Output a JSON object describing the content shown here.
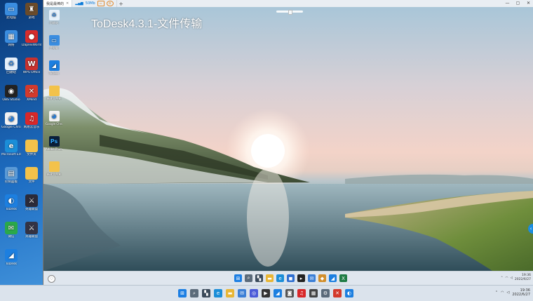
{
  "window": {
    "overlay_title": "ToDesk4.3.1-文件传输",
    "tabs": [
      {
        "label": "我是最棒的",
        "active": true
      },
      {
        "label": "50Mb",
        "active": false
      }
    ],
    "controls": {
      "minimize": "—",
      "maximize": "▢",
      "close": "✕"
    },
    "add_tab": "+"
  },
  "outer_desktop_icons": [
    {
      "label": "此电脑",
      "icon": "computer-icon",
      "color": "#3a8de0",
      "glyph": "▭"
    },
    {
      "label": "游戏",
      "icon": "game-icon",
      "color": "#6a4b2a",
      "glyph": "♜"
    },
    {
      "label": "网络",
      "icon": "network-icon",
      "color": "#3a8de0",
      "glyph": "▦"
    },
    {
      "label": "DaplexWorld",
      "icon": "app-icon",
      "color": "#d62c2c",
      "glyph": "●"
    },
    {
      "label": "回收站",
      "icon": "recycle-bin-icon",
      "color": "#e6f0fa",
      "glyph": "♻"
    },
    {
      "label": "WPS Office",
      "icon": "wps-icon",
      "color": "#c8322f",
      "glyph": "W"
    },
    {
      "label": "OBS Studio",
      "icon": "obs-icon",
      "color": "#222222",
      "glyph": "◉"
    },
    {
      "label": "XMind",
      "icon": "xmind-icon",
      "color": "#d33a2c",
      "glyph": "✕"
    },
    {
      "label": "Google Chrome",
      "icon": "chrome-icon",
      "color": "#f2f2f2",
      "glyph": "◕"
    },
    {
      "label": "网易云音乐",
      "icon": "music-icon",
      "color": "#d8282a",
      "glyph": "♫"
    },
    {
      "label": "Microsoft Edge",
      "icon": "edge-icon",
      "color": "#1b8ed8",
      "glyph": "e"
    },
    {
      "label": "文件夹",
      "icon": "folder-icon",
      "color": "#f3c24a",
      "glyph": ""
    },
    {
      "label": "控制面板",
      "icon": "control-panel-icon",
      "color": "#5a9ad6",
      "glyph": "▤"
    },
    {
      "label": "文件",
      "icon": "folder-icon",
      "color": "#f3c24a",
      "glyph": ""
    },
    {
      "label": "ToDesk",
      "icon": "todesk-icon",
      "color": "#1c7fe0",
      "glyph": "◐"
    },
    {
      "label": "英雄联盟",
      "icon": "game-icon",
      "color": "#2b2b3a",
      "glyph": "⚔"
    },
    {
      "label": "微信",
      "icon": "wechat-icon",
      "color": "#2aa84a",
      "glyph": "✉"
    },
    {
      "label": "英雄联盟",
      "icon": "game-icon",
      "color": "#333344",
      "glyph": "⚔"
    },
    {
      "label": "ToDesk",
      "icon": "todesk-icon",
      "color": "#1c7fe0",
      "glyph": "◢"
    }
  ],
  "remote_desktop_icons": [
    {
      "label": "回收站",
      "icon": "recycle-bin-icon",
      "color": "#e6f0fa",
      "glyph": "♻"
    },
    {
      "label": "此电脑",
      "icon": "computer-icon",
      "color": "#3a8de0",
      "glyph": "▭"
    },
    {
      "label": "ToDesk",
      "icon": "todesk-icon",
      "color": "#1c7fe0",
      "glyph": "◢"
    },
    {
      "label": "新建文件夹",
      "icon": "folder-icon",
      "color": "#f3c24a",
      "glyph": ""
    },
    {
      "label": "Google Chrome",
      "icon": "chrome-icon",
      "color": "#f2f2f2",
      "glyph": "◕"
    },
    {
      "label": "Adobe Photoshop",
      "icon": "photoshop-icon",
      "color": "#0b1f3a",
      "glyph": "Ps"
    },
    {
      "label": "新建文件夹",
      "icon": "folder-icon",
      "color": "#f3c24a",
      "glyph": ""
    }
  ],
  "remote_taskbar": {
    "apps": [
      {
        "name": "start-button",
        "color": "#1d7fe3",
        "glyph": "⊞"
      },
      {
        "name": "search-icon",
        "color": "#5b6b7a",
        "glyph": "⌕"
      },
      {
        "name": "task-view-icon",
        "color": "#3a4a5a",
        "glyph": "▚"
      },
      {
        "name": "file-explorer-icon",
        "color": "#e8b635",
        "glyph": "▬"
      },
      {
        "name": "edge-icon",
        "color": "#1b8ed8",
        "glyph": "e"
      },
      {
        "name": "store-icon",
        "color": "#2f6fd1",
        "glyph": "◼"
      },
      {
        "name": "terminal-icon",
        "color": "#222222",
        "glyph": "▸"
      },
      {
        "name": "mail-icon",
        "color": "#3b7fd6",
        "glyph": "✉"
      },
      {
        "name": "app-icon",
        "color": "#d28f2c",
        "glyph": "◆"
      },
      {
        "name": "todesk-icon",
        "color": "#1c7fe0",
        "glyph": "◢"
      },
      {
        "name": "excel-icon",
        "color": "#1f7c45",
        "glyph": "X"
      }
    ],
    "time": "19:36",
    "date": "2022/6/27"
  },
  "taskbar": {
    "apps": [
      {
        "name": "start-button",
        "color": "#1d7fe3",
        "glyph": "⊞"
      },
      {
        "name": "search-icon",
        "color": "#5b6b7a",
        "glyph": "⌕"
      },
      {
        "name": "task-view-icon",
        "color": "#3a4a5a",
        "glyph": "▚"
      },
      {
        "name": "edge-icon",
        "color": "#1b8ed8",
        "glyph": "e"
      },
      {
        "name": "file-explorer-icon",
        "color": "#e8b635",
        "glyph": "▬"
      },
      {
        "name": "mail-icon",
        "color": "#3b7fd6",
        "glyph": "✉"
      },
      {
        "name": "app-icon",
        "color": "#4a5ad8",
        "glyph": "◎"
      },
      {
        "name": "media-player-icon",
        "color": "#333333",
        "glyph": "▶"
      },
      {
        "name": "todesk-icon",
        "color": "#1c7fe0",
        "glyph": "◢"
      },
      {
        "name": "photo-icon",
        "color": "#555555",
        "glyph": "◙"
      },
      {
        "name": "music-icon",
        "color": "#d8282a",
        "glyph": "♫"
      },
      {
        "name": "calculator-icon",
        "color": "#444444",
        "glyph": "▦"
      },
      {
        "name": "settings-icon",
        "color": "#5a6a7a",
        "glyph": "⚙"
      },
      {
        "name": "xmind-icon",
        "color": "#d33a2c",
        "glyph": "✕"
      },
      {
        "name": "todesk-icon",
        "color": "#1c7fe0",
        "glyph": "◐"
      }
    ],
    "time": "19:36",
    "date": "2022/6/27"
  }
}
